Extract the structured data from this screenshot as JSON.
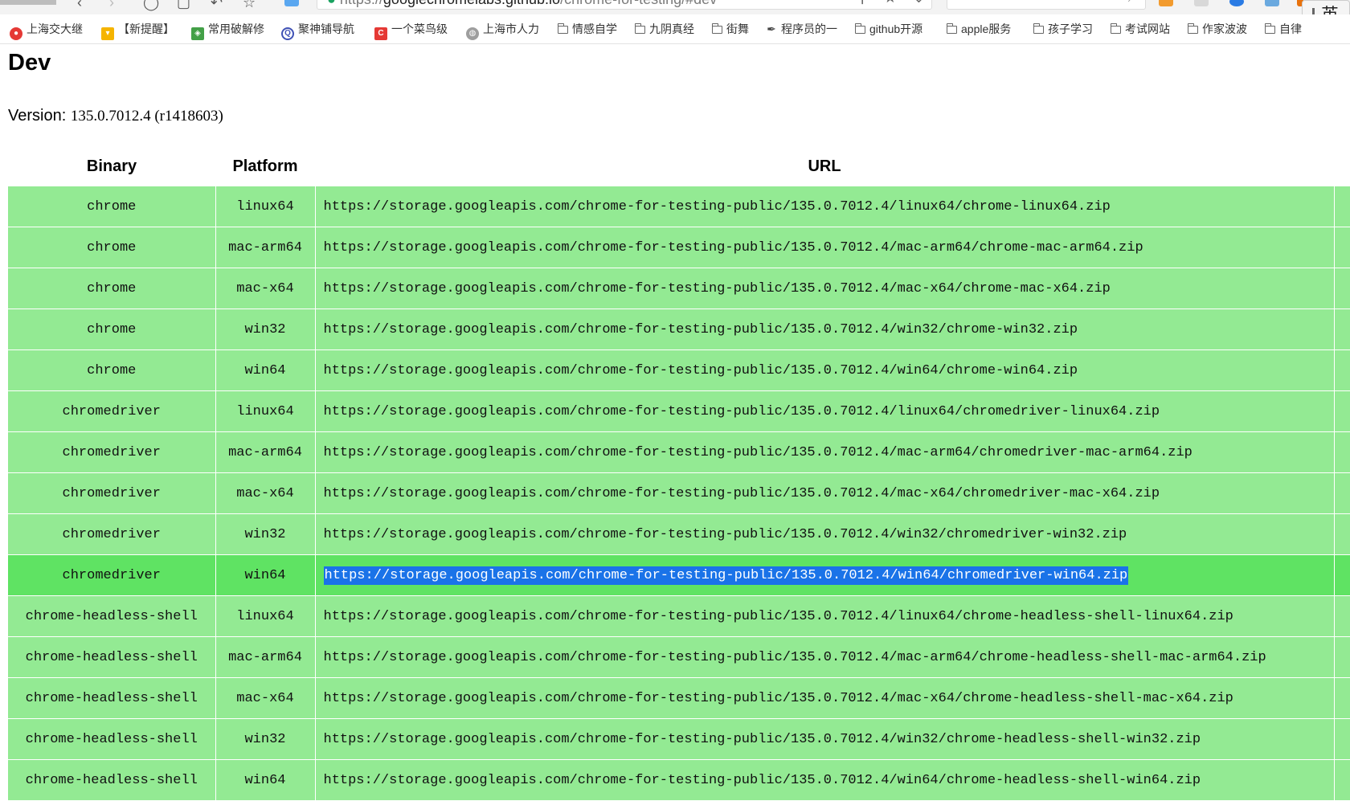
{
  "browser": {
    "address_url": "https://googlechromelabs.github.io/chrome-for-testing/#dev",
    "address_secure": "https://",
    "address_host": "googlechromelabs.github.io",
    "address_path": "/chrome-for-testing/#dev",
    "ime_label": "英",
    "bookmarks": [
      {
        "label": "上海交大继",
        "icon": "red-circle-icon"
      },
      {
        "label": "【新提醒】",
        "icon": "award-icon"
      },
      {
        "label": "常用破解修",
        "icon": "layers-icon"
      },
      {
        "label": "聚神铺导航",
        "icon": "q-logo-icon"
      },
      {
        "label": "一个菜鸟级",
        "icon": "c-logo-icon"
      },
      {
        "label": "上海市人力",
        "icon": "globe-icon"
      },
      {
        "label": "情感自学",
        "icon": "folder-icon"
      },
      {
        "label": "九阴真经",
        "icon": "folder-icon"
      },
      {
        "label": "街舞",
        "icon": "folder-icon"
      },
      {
        "label": "程序员的一",
        "icon": "feather-icon"
      },
      {
        "label": "github开源",
        "icon": "folder-icon"
      },
      {
        "label": "apple服务",
        "icon": "folder-icon"
      },
      {
        "label": "孩子学习",
        "icon": "folder-icon"
      },
      {
        "label": "考试网站",
        "icon": "folder-icon"
      },
      {
        "label": "作家波波",
        "icon": "folder-icon"
      },
      {
        "label": "自律",
        "icon": "folder-icon"
      }
    ]
  },
  "page": {
    "title": "Dev",
    "version_label": "Version:",
    "version_value": "135.0.7012.4 (r1418603)"
  },
  "table": {
    "headers": {
      "binary": "Binary",
      "platform": "Platform",
      "url": "URL"
    },
    "selected_row_index": 9,
    "rows": [
      {
        "binary": "chrome",
        "platform": "linux64",
        "url": "https://storage.googleapis.com/chrome-for-testing-public/135.0.7012.4/linux64/chrome-linux64.zip"
      },
      {
        "binary": "chrome",
        "platform": "mac-arm64",
        "url": "https://storage.googleapis.com/chrome-for-testing-public/135.0.7012.4/mac-arm64/chrome-mac-arm64.zip"
      },
      {
        "binary": "chrome",
        "platform": "mac-x64",
        "url": "https://storage.googleapis.com/chrome-for-testing-public/135.0.7012.4/mac-x64/chrome-mac-x64.zip"
      },
      {
        "binary": "chrome",
        "platform": "win32",
        "url": "https://storage.googleapis.com/chrome-for-testing-public/135.0.7012.4/win32/chrome-win32.zip"
      },
      {
        "binary": "chrome",
        "platform": "win64",
        "url": "https://storage.googleapis.com/chrome-for-testing-public/135.0.7012.4/win64/chrome-win64.zip"
      },
      {
        "binary": "chromedriver",
        "platform": "linux64",
        "url": "https://storage.googleapis.com/chrome-for-testing-public/135.0.7012.4/linux64/chromedriver-linux64.zip"
      },
      {
        "binary": "chromedriver",
        "platform": "mac-arm64",
        "url": "https://storage.googleapis.com/chrome-for-testing-public/135.0.7012.4/mac-arm64/chromedriver-mac-arm64.zip"
      },
      {
        "binary": "chromedriver",
        "platform": "mac-x64",
        "url": "https://storage.googleapis.com/chrome-for-testing-public/135.0.7012.4/mac-x64/chromedriver-mac-x64.zip"
      },
      {
        "binary": "chromedriver",
        "platform": "win32",
        "url": "https://storage.googleapis.com/chrome-for-testing-public/135.0.7012.4/win32/chromedriver-win32.zip"
      },
      {
        "binary": "chromedriver",
        "platform": "win64",
        "url": "https://storage.googleapis.com/chrome-for-testing-public/135.0.7012.4/win64/chromedriver-win64.zip"
      },
      {
        "binary": "chrome-headless-shell",
        "platform": "linux64",
        "url": "https://storage.googleapis.com/chrome-for-testing-public/135.0.7012.4/linux64/chrome-headless-shell-linux64.zip"
      },
      {
        "binary": "chrome-headless-shell",
        "platform": "mac-arm64",
        "url": "https://storage.googleapis.com/chrome-for-testing-public/135.0.7012.4/mac-arm64/chrome-headless-shell-mac-arm64.zip"
      },
      {
        "binary": "chrome-headless-shell",
        "platform": "mac-x64",
        "url": "https://storage.googleapis.com/chrome-for-testing-public/135.0.7012.4/mac-x64/chrome-headless-shell-mac-x64.zip"
      },
      {
        "binary": "chrome-headless-shell",
        "platform": "win32",
        "url": "https://storage.googleapis.com/chrome-for-testing-public/135.0.7012.4/win32/chrome-headless-shell-win32.zip"
      },
      {
        "binary": "chrome-headless-shell",
        "platform": "win64",
        "url": "https://storage.googleapis.com/chrome-for-testing-public/135.0.7012.4/win64/chrome-headless-shell-win64.zip"
      }
    ]
  },
  "colors": {
    "row_bg": "#93ea93",
    "row_selected_bg": "#5fe363",
    "text_selection_bg": "#1a73e8"
  }
}
